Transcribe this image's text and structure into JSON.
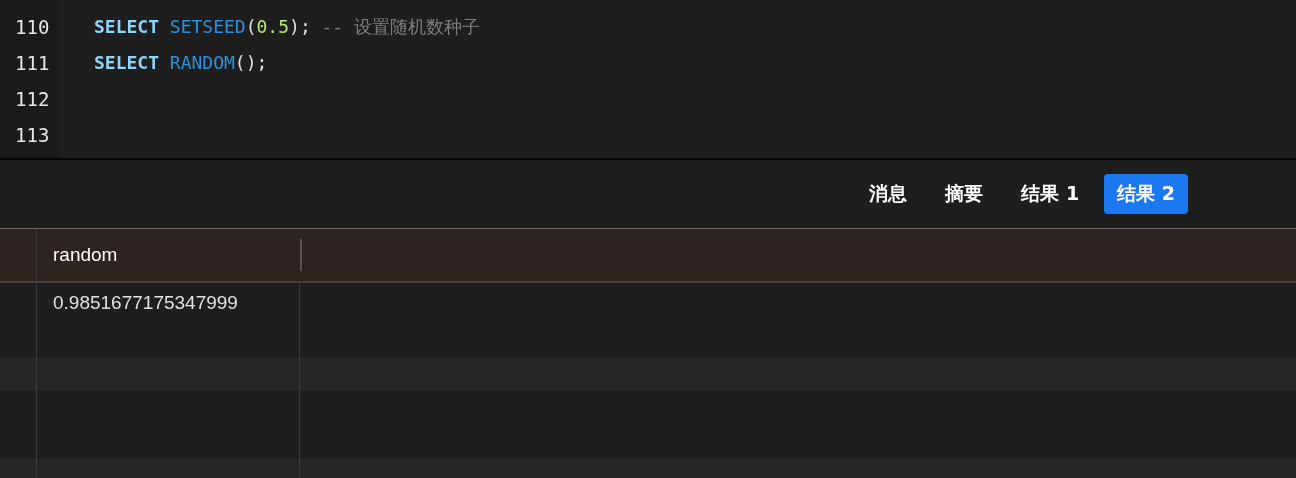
{
  "editor": {
    "lines": [
      {
        "number": "110",
        "tokens": [
          {
            "kind": "keyword",
            "text": "SELECT",
            "space_after": true
          },
          {
            "kind": "function",
            "text": "SETSEED"
          },
          {
            "kind": "punct",
            "text": "("
          },
          {
            "kind": "number",
            "text": "0.5"
          },
          {
            "kind": "punct",
            "text": ");",
            "space_after": true
          },
          {
            "kind": "comment",
            "text": "-- 设置随机数种子"
          }
        ]
      },
      {
        "number": "111",
        "tokens": [
          {
            "kind": "keyword",
            "text": "SELECT",
            "space_after": true
          },
          {
            "kind": "function",
            "text": "RANDOM"
          },
          {
            "kind": "punct",
            "text": "();"
          }
        ]
      },
      {
        "number": "112"
      },
      {
        "number": "113"
      }
    ]
  },
  "tabs": [
    {
      "label": "消息",
      "selected": false
    },
    {
      "label": "摘要",
      "selected": false
    },
    {
      "label": "结果 1",
      "selected": false
    },
    {
      "label": "结果 2",
      "selected": true
    }
  ],
  "table": {
    "columns": [
      "random"
    ],
    "rows": [
      [
        "0.9851677175347999"
      ]
    ]
  }
}
